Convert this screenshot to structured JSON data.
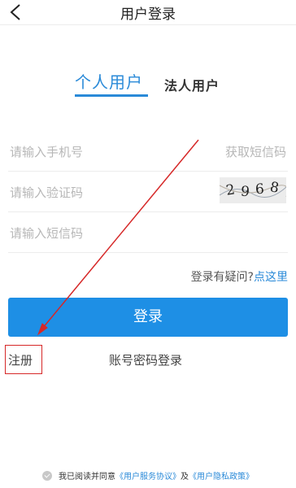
{
  "header": {
    "title": "用户登录"
  },
  "tabs": {
    "personal": "个人用户",
    "legal": "法人用户"
  },
  "form": {
    "phone_placeholder": "请输入手机号",
    "get_code": "获取短信码",
    "captcha_placeholder": "请输入验证码",
    "captcha_digits": [
      "2",
      "9",
      "6",
      "8"
    ],
    "sms_placeholder": "请输入短信码"
  },
  "help": {
    "question": "登录有疑问?",
    "link": "点这里"
  },
  "login_button": "登录",
  "register": "注册",
  "password_login": "账号密码登录",
  "agreement": {
    "prefix": "我已阅读并同意",
    "service": "《用户服务协议》",
    "and": "及",
    "privacy": "《用户隐私政策》"
  },
  "colors": {
    "accent": "#2a8ad8",
    "button": "#1e8fe5",
    "annotation": "#d62828"
  }
}
